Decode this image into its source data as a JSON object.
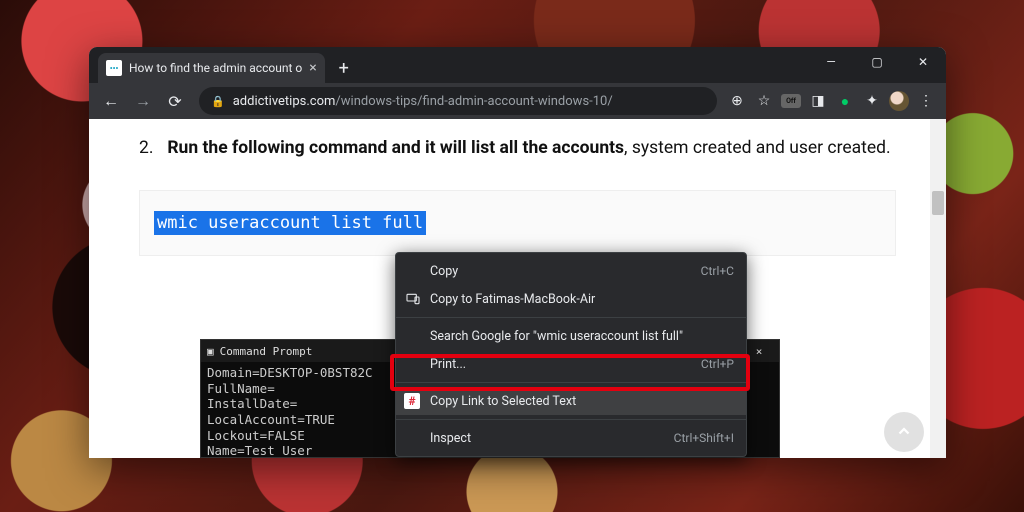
{
  "tab": {
    "title": "How to find the admin account o",
    "favicon_label": "•••"
  },
  "window_controls": {
    "min": "—",
    "max": "▢",
    "close": "✕"
  },
  "toolbar": {
    "url_domain": "addictivetips.com",
    "url_path": "/windows-tips/find-admin-account-windows-10/",
    "ext_off": "Off"
  },
  "article": {
    "list_number": "2.",
    "bold_text": "Run the following command and it will list all the accounts",
    "rest_text": ", system created and user created."
  },
  "code": {
    "selected": "wmic useraccount list full"
  },
  "cmd": {
    "title": "Command Prompt",
    "lines": [
      "Domain=DESKTOP-0BST82C",
      "FullName=",
      "InstallDate=",
      "LocalAccount=TRUE",
      "Lockout=FALSE",
      "Name=Test User"
    ]
  },
  "menu": {
    "copy": "Copy",
    "copy_sc": "Ctrl+C",
    "copy_to": "Copy to Fatimas-MacBook-Air",
    "search": "Search Google for \"wmic useraccount list full\"",
    "print": "Print...",
    "print_sc": "Ctrl+P",
    "copy_link": "Copy Link to Selected Text",
    "inspect": "Inspect",
    "inspect_sc": "Ctrl+Shift+I"
  }
}
